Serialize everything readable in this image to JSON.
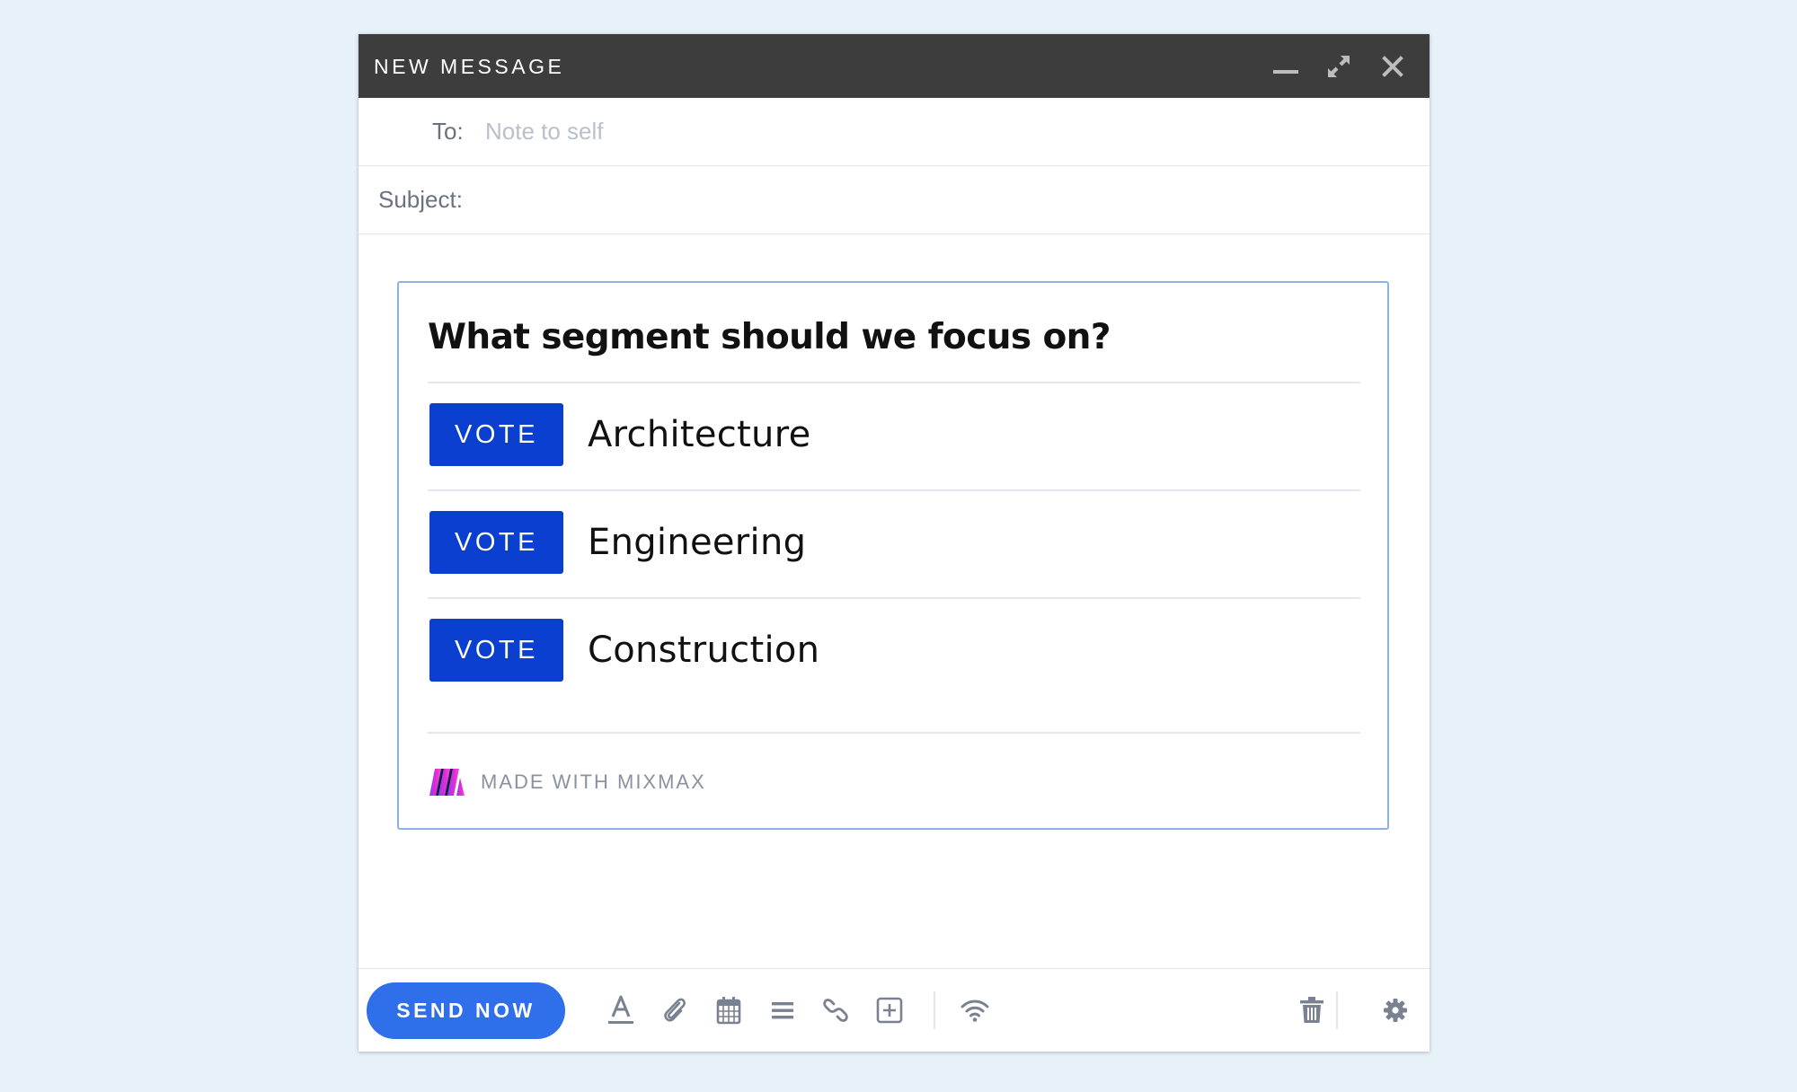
{
  "window": {
    "title": "NEW MESSAGE",
    "controls": [
      "minimize-icon",
      "expand-icon",
      "close-icon"
    ]
  },
  "compose": {
    "to_label": "To:",
    "to_placeholder": "Note to self",
    "to_value": "",
    "subject_label": "Subject:",
    "subject_value": ""
  },
  "poll": {
    "question": "What segment should we focus on?",
    "options": [
      {
        "button_label": "VOTE",
        "label": "Architecture"
      },
      {
        "button_label": "VOTE",
        "label": "Engineering"
      },
      {
        "button_label": "VOTE",
        "label": "Construction"
      }
    ],
    "footer_text": "MADE WITH MIXMAX"
  },
  "toolbar": {
    "send_label": "SEND NOW",
    "tools": [
      "text-format-icon",
      "paperclip-icon",
      "calendar-icon",
      "list-icon",
      "link-icon",
      "add-icon",
      "wifi-icon",
      "trash-icon",
      "gear-icon"
    ]
  },
  "colors": {
    "background": "#e6f1f8",
    "titlebar": "#3d3d3d",
    "vote_button": "#0a3fcf",
    "send_button": "#2f6fe9",
    "poll_border": "#8eb3e2",
    "icon": "#7a8190"
  }
}
